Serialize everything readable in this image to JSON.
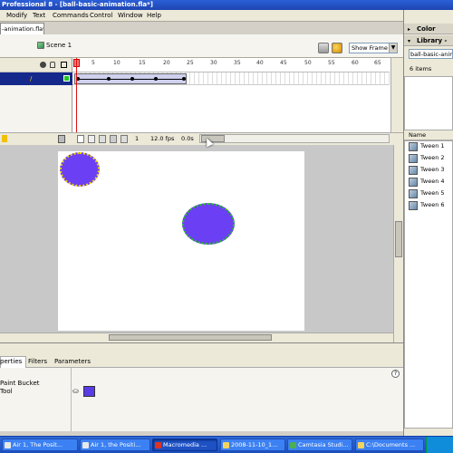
{
  "window": {
    "title": "Professional 8 - [ball-basic-animation.fla*]"
  },
  "menu": [
    "Modify",
    "Text",
    "Commands",
    "Control",
    "Window",
    "Help"
  ],
  "document": {
    "tab_label": "-animation.fla*",
    "scene_label": "Scene 1",
    "zoom_select": "Show Frame"
  },
  "timeline": {
    "ruler_ticks": [
      "1",
      "5",
      "10",
      "15",
      "20",
      "25",
      "30",
      "35",
      "40",
      "45",
      "50",
      "55",
      "60",
      "65"
    ],
    "frame_number": "1",
    "fps": "12.0 fps",
    "time": "0.0s"
  },
  "properties": {
    "tabs": [
      "perties",
      "Filters",
      "Parameters"
    ],
    "tool_name_line1": "Paint Bucket",
    "tool_name_line2": "Tool",
    "fill_color": "#5a3be5"
  },
  "right_panel": {
    "color_header": "Color",
    "library_header": "Library -",
    "library_select": "ball-basic-animati",
    "item_count": "6 items",
    "name_column": "Name",
    "items": [
      "Tween 1",
      "Tween 2",
      "Tween 3",
      "Tween 4",
      "Tween 5",
      "Tween 6"
    ]
  },
  "taskbar": {
    "tasks": [
      {
        "label": "Air 1, The Posit..."
      },
      {
        "label": "Air 1, the Positi..."
      },
      {
        "label": "Macromedia ..."
      },
      {
        "label": "2008-11-10_1..."
      },
      {
        "label": "Camtasia Studi..."
      },
      {
        "label": "C:\\Documents ..."
      }
    ]
  },
  "colors": {
    "ball": "#6b3ff3",
    "layer_selected": "#15288b",
    "taskbar": "#3168d5"
  }
}
